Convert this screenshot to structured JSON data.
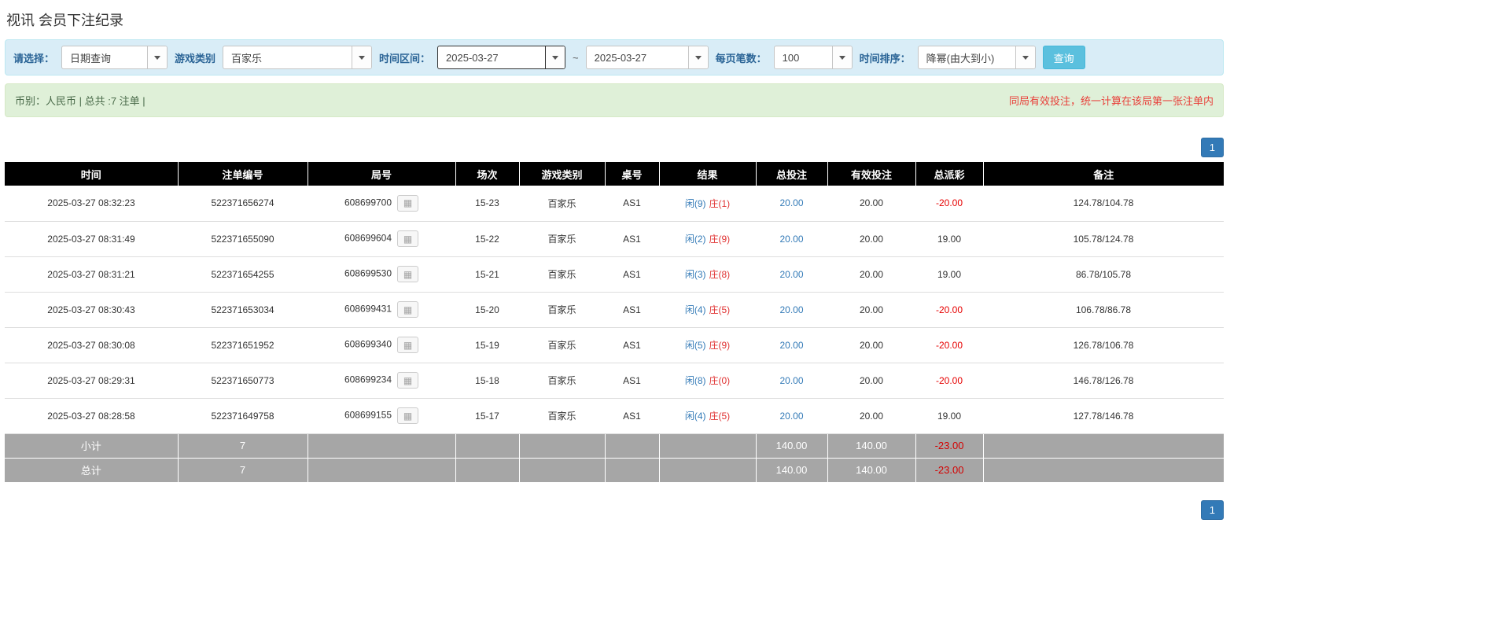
{
  "page": {
    "title": "视讯 会员下注纪录"
  },
  "filter": {
    "select_label": "请选择：",
    "select_value": "日期查询",
    "game_type_label": "游戏类别",
    "game_type_value": "百家乐",
    "time_range_label": "时间区间：",
    "date_from": "2025-03-27",
    "range_separator": "~",
    "date_to": "2025-03-27",
    "page_size_label": "每页笔数：",
    "page_size_value": "100",
    "sort_label": "时间排序：",
    "sort_value": "降幂(由大到小)",
    "search_button_label": "查询"
  },
  "notice": {
    "left": "币别：人民币 | 总共 :7 注单 |",
    "right": "同局有效投注，统一计算在该局第一张注单内"
  },
  "pagination": {
    "top": "1",
    "bottom": "1"
  },
  "table": {
    "headers": [
      "时间",
      "注单编号",
      "局号",
      "场次",
      "游戏类别",
      "桌号",
      "结果",
      "总投注",
      "有效投注",
      "总派彩",
      "备注"
    ],
    "rows": [
      {
        "time": "2025-03-27 08:32:23",
        "bet_id": "522371656274",
        "round": "608699700",
        "session": "15-23",
        "game": "百家乐",
        "table": "AS1",
        "player": "闲(9)",
        "banker": "庄(1)",
        "total_bet": "20.00",
        "valid_bet": "20.00",
        "payout": "-20.00",
        "note": "124.78/104.78"
      },
      {
        "time": "2025-03-27 08:31:49",
        "bet_id": "522371655090",
        "round": "608699604",
        "session": "15-22",
        "game": "百家乐",
        "table": "AS1",
        "player": "闲(2)",
        "banker": "庄(9)",
        "total_bet": "20.00",
        "valid_bet": "20.00",
        "payout": "19.00",
        "note": "105.78/124.78"
      },
      {
        "time": "2025-03-27 08:31:21",
        "bet_id": "522371654255",
        "round": "608699530",
        "session": "15-21",
        "game": "百家乐",
        "table": "AS1",
        "player": "闲(3)",
        "banker": "庄(8)",
        "total_bet": "20.00",
        "valid_bet": "20.00",
        "payout": "19.00",
        "note": "86.78/105.78"
      },
      {
        "time": "2025-03-27 08:30:43",
        "bet_id": "522371653034",
        "round": "608699431",
        "session": "15-20",
        "game": "百家乐",
        "table": "AS1",
        "player": "闲(4)",
        "banker": "庄(5)",
        "total_bet": "20.00",
        "valid_bet": "20.00",
        "payout": "-20.00",
        "note": "106.78/86.78"
      },
      {
        "time": "2025-03-27 08:30:08",
        "bet_id": "522371651952",
        "round": "608699340",
        "session": "15-19",
        "game": "百家乐",
        "table": "AS1",
        "player": "闲(5)",
        "banker": "庄(9)",
        "total_bet": "20.00",
        "valid_bet": "20.00",
        "payout": "-20.00",
        "note": "126.78/106.78"
      },
      {
        "time": "2025-03-27 08:29:31",
        "bet_id": "522371650773",
        "round": "608699234",
        "session": "15-18",
        "game": "百家乐",
        "table": "AS1",
        "player": "闲(8)",
        "banker": "庄(0)",
        "total_bet": "20.00",
        "valid_bet": "20.00",
        "payout": "-20.00",
        "note": "146.78/126.78"
      },
      {
        "time": "2025-03-27 08:28:58",
        "bet_id": "522371649758",
        "round": "608699155",
        "session": "15-17",
        "game": "百家乐",
        "table": "AS1",
        "player": "闲(4)",
        "banker": "庄(5)",
        "total_bet": "20.00",
        "valid_bet": "20.00",
        "payout": "19.00",
        "note": "127.78/146.78"
      }
    ],
    "subtotal": {
      "label": "小计",
      "count": "7",
      "total_bet": "140.00",
      "valid_bet": "140.00",
      "payout": "-23.00"
    },
    "total": {
      "label": "总计",
      "count": "7",
      "total_bet": "140.00",
      "valid_bet": "140.00",
      "payout": "-23.00"
    }
  },
  "icons": {
    "round_detail": "bead-road-grid-icon",
    "dropdown": "chevron-down-icon"
  },
  "colors": {
    "accent_blue": "#337ab7",
    "player_blue": "#337ab7",
    "banker_red": "#e03333",
    "negative_red": "#e60000",
    "header_bg": "#000000",
    "footer_bg": "#a6a6a6",
    "filter_bg": "#d9edf7",
    "notice_bg": "#dff0d8",
    "notice_red": "#e8403a",
    "search_btn": "#5bc0de"
  }
}
